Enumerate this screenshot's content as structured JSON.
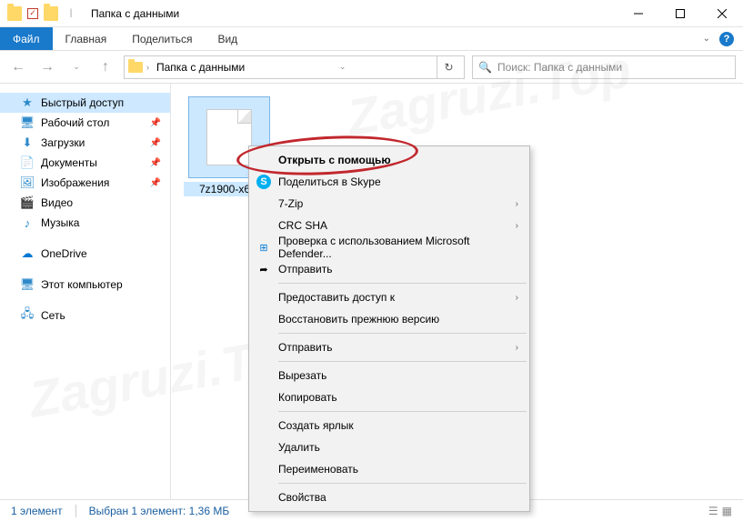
{
  "window": {
    "title": "Папка с данными"
  },
  "ribbon": {
    "file": "Файл",
    "tabs": [
      "Главная",
      "Поделиться",
      "Вид"
    ]
  },
  "address": {
    "crumb": "Папка с данными",
    "search_placeholder": "Поиск: Папка с данными"
  },
  "nav": {
    "quick": "Быстрый доступ",
    "desktop": "Рабочий стол",
    "downloads": "Загрузки",
    "documents": "Документы",
    "pictures": "Изображения",
    "videos": "Видео",
    "music": "Музыка",
    "onedrive": "OneDrive",
    "thispc": "Этот компьютер",
    "network": "Сеть"
  },
  "file": {
    "name": "7z1900-x6..."
  },
  "context": {
    "open_with": "Открыть с помощью",
    "skype": "Поделиться в Skype",
    "sevenzip": "7-Zip",
    "crc": "CRC SHA",
    "defender": "Проверка с использованием Microsoft Defender...",
    "send": "Отправить",
    "give_access": "Предоставить доступ к",
    "restore": "Восстановить прежнюю версию",
    "send_to": "Отправить",
    "cut": "Вырезать",
    "copy": "Копировать",
    "shortcut": "Создать ярлык",
    "delete": "Удалить",
    "rename": "Переименовать",
    "properties": "Свойства"
  },
  "status": {
    "count": "1 элемент",
    "selected": "Выбран 1 элемент: 1,36 МБ"
  },
  "watermark1": "Zagruzi.Top",
  "watermark2": "Zagruzi.Top"
}
